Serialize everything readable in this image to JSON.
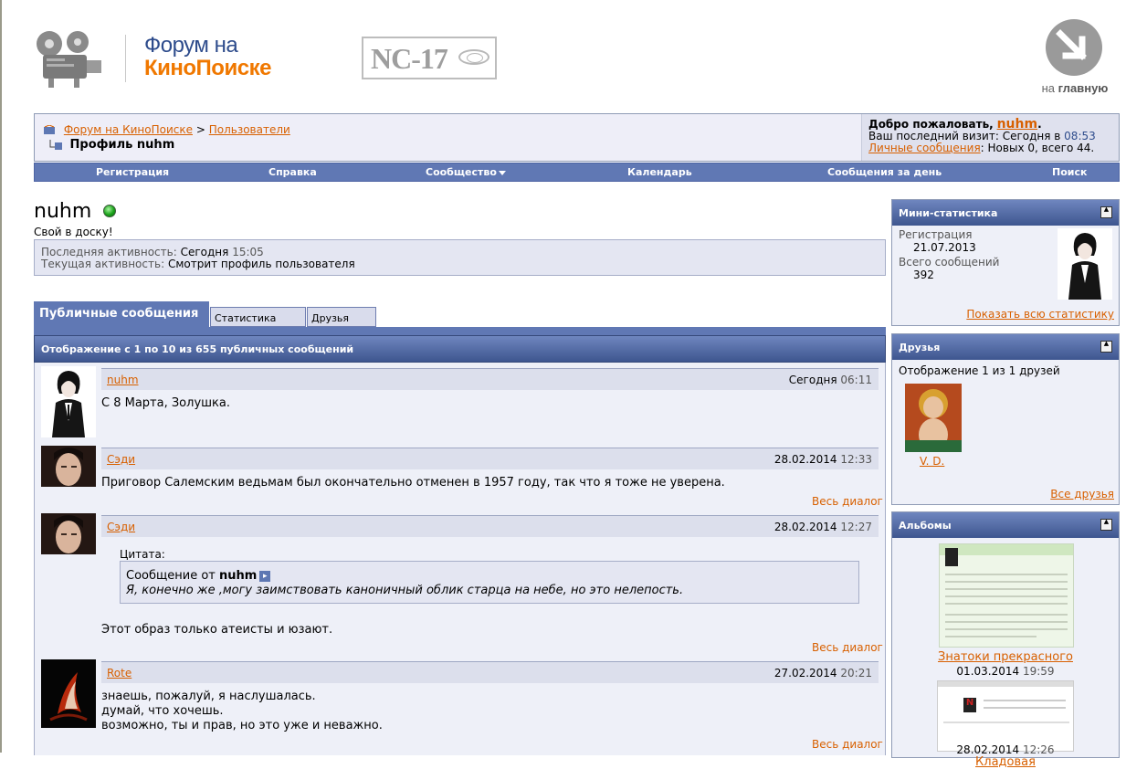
{
  "header": {
    "logo_line1": "Форум на",
    "logo_line2": "КиноПоиске",
    "rating_badge": "NC-17",
    "home_label_prefix": "на",
    "home_label_bold": "главную"
  },
  "breadcrumb": {
    "forum": "Форум на КиноПоиске",
    "separator": ">",
    "users": "Пользователи",
    "current": "Профиль nuhm"
  },
  "welcome": {
    "greeting": "Добро пожаловать,",
    "username": "nuhm",
    "dot": ".",
    "last_visit_label": "Ваш последний визит:",
    "last_visit_day": "Сегодня в",
    "last_visit_time": "08:53",
    "pm_link": "Личные сообщения",
    "pm_stats": ": Новых 0, всего 44."
  },
  "menu": {
    "items": [
      "Регистрация",
      "Справка",
      "Сообщество",
      "Календарь",
      "Сообщения за день",
      "Поиск"
    ]
  },
  "profile": {
    "username": "nuhm",
    "status": "Свой в доску!",
    "last_activity_label": "Последняя активность:",
    "last_activity_day": "Сегодня",
    "last_activity_time": "15:05",
    "current_activity_label": "Текущая активность:",
    "current_activity_value": "Смотрит профиль пользователя"
  },
  "tabs": [
    "Публичные сообщения",
    "Статистика",
    "Друзья"
  ],
  "messages": {
    "header": "Отображение с 1 по 10 из 655 публичных сообщений",
    "dialog_link": "Весь диалог",
    "quote_label": "Цитата:",
    "quote_from": "Сообщение от",
    "quote_author": "nuhm",
    "quote_text": "Я, конечно же ,могу заимствовать каноничный облик старца на небе, но это нелепость.",
    "items": [
      {
        "author": "nuhm",
        "date": "Сегодня",
        "time": "06:11",
        "text": "С 8 Марта, Золушка."
      },
      {
        "author": "Сэди",
        "date": "28.02.2014",
        "time": "12:33",
        "text": "Приговор Салемским ведьмам был окончательно отменен в 1957 году, так что я тоже не уверена."
      },
      {
        "author": "Сэди",
        "date": "28.02.2014",
        "time": "12:27",
        "text": "Этот образ только атеисты и юзают."
      },
      {
        "author": "Rote",
        "date": "27.02.2014",
        "time": "20:21",
        "text_lines": [
          "знаешь, пожалуй, я наслушалась.",
          "думай, что хочешь.",
          "возможно, ты и прав, но это уже и неважно."
        ]
      }
    ]
  },
  "sidebar": {
    "ministats": {
      "title": "Мини-статистика",
      "reg_label": "Регистрация",
      "reg_value": "21.07.2013",
      "posts_label": "Всего сообщений",
      "posts_value": "392",
      "more": "Показать всю статистику"
    },
    "friends": {
      "title": "Друзья",
      "summary": "Отображение 1 из 1 друзей",
      "friend_name": "V. D.",
      "more": "Все друзья"
    },
    "albums": {
      "title": "Альбомы",
      "items": [
        {
          "name": "Знатоки прекрасного",
          "date": "01.03.2014",
          "time": "19:59"
        },
        {
          "name": "Кладовая",
          "date": "28.02.2014",
          "time": "12:26"
        }
      ]
    }
  }
}
